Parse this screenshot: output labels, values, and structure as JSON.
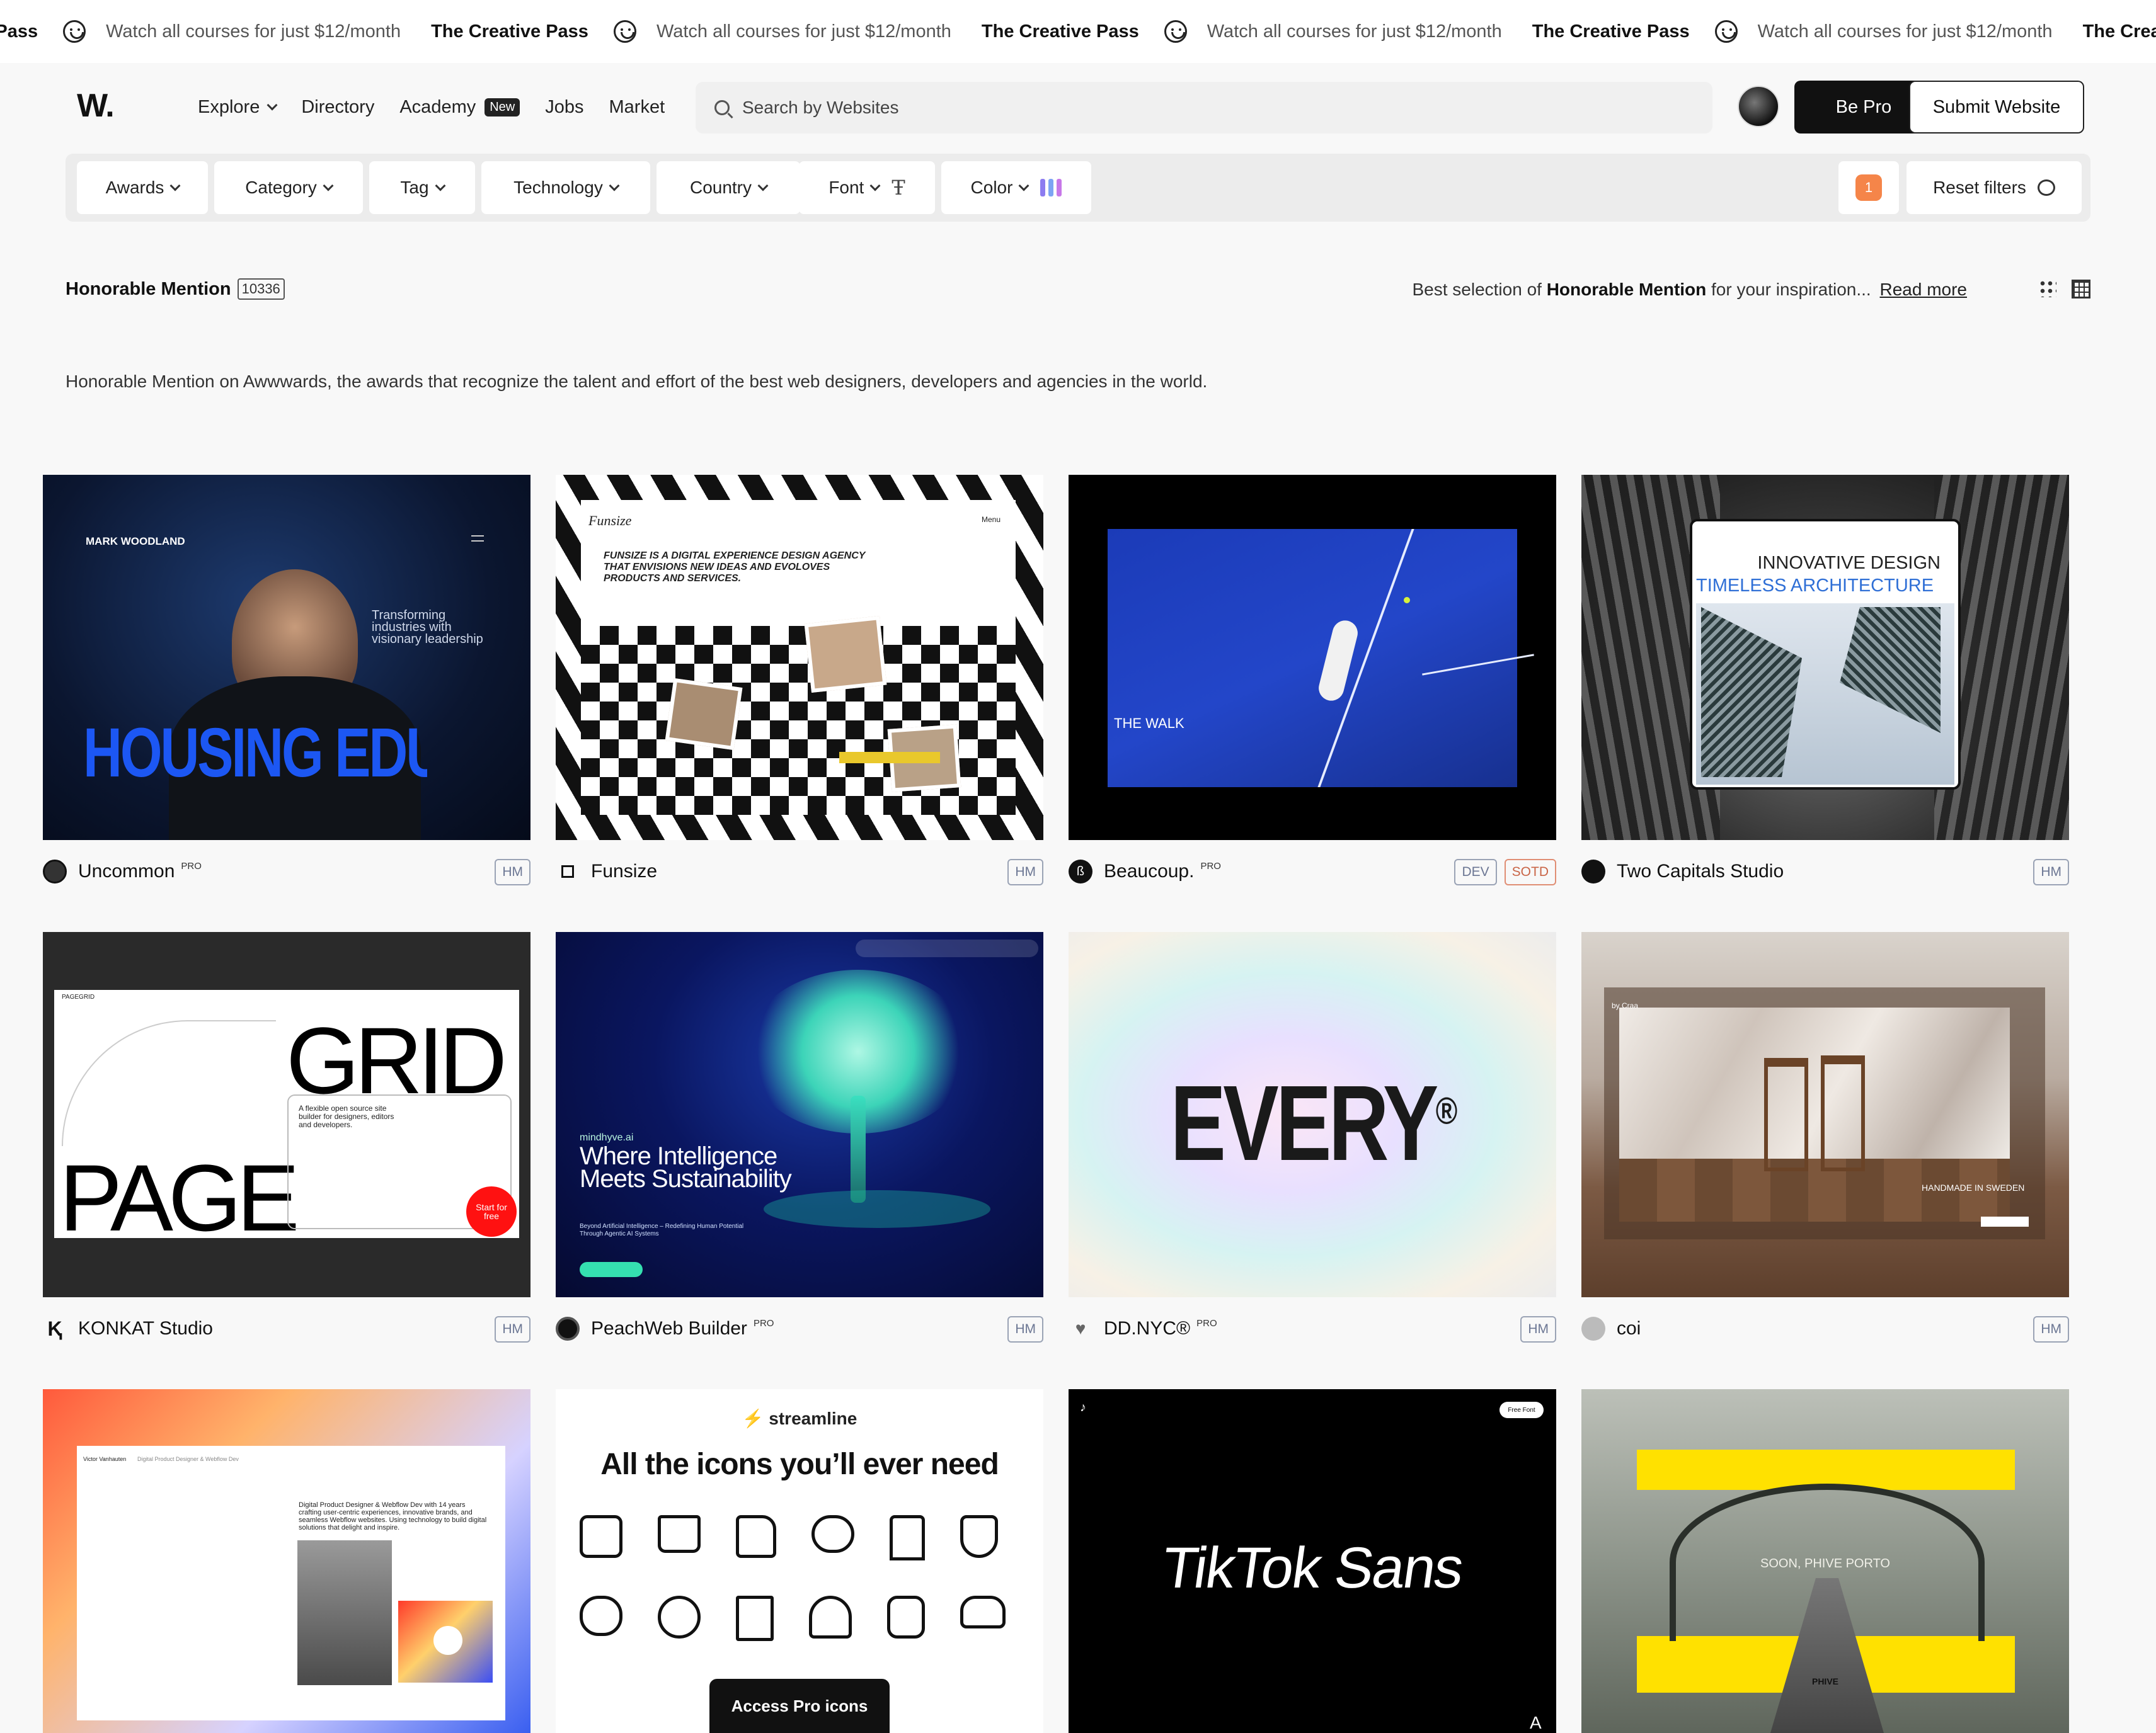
{
  "marquee": {
    "title_partial": "ive Pass",
    "title": "The Creative Pass",
    "text": "Watch all courses for just $12/month"
  },
  "header": {
    "logo": "W.",
    "nav": [
      {
        "label": "Explore"
      },
      {
        "label": "Directory"
      },
      {
        "label": "Academy",
        "badge": "New"
      },
      {
        "label": "Jobs"
      },
      {
        "label": "Market"
      }
    ],
    "search_placeholder": "Search by Websites",
    "be_pro": "Be Pro",
    "submit": "Submit Website"
  },
  "filters": {
    "items": [
      "Awards",
      "Category",
      "Tag",
      "Technology",
      "Country",
      "Font",
      "Color"
    ],
    "color_bars": [
      "#8c7cf0",
      "#7da4f3",
      "#c778e8"
    ],
    "count": "1",
    "reset": "Reset filters",
    "accent": "#f58549"
  },
  "section": {
    "title": "Honorable Mention",
    "count": "10336",
    "best_prefix": "Best selection of",
    "best_bold": "Honorable Mention",
    "best_suffix": "for your inspiration...",
    "read_more": "Read more",
    "description": "Honorable Mention on Awwwards, the awards that recognize the talent and effort of the best web designers, developers and agencies in the world."
  },
  "cards": [
    {
      "name": "Uncommon",
      "pro": "PRO",
      "tags": [
        "HM"
      ],
      "thumb": {
        "brand": "MARK WOODLAND",
        "tagline": "Transforming industries with visionary leadership",
        "hero": "HOUSING EDUCATION"
      }
    },
    {
      "name": "Funsize",
      "pro": "",
      "tags": [
        "HM"
      ],
      "thumb": {
        "brand": "Funsize",
        "menu": "Menu",
        "headline": "FUNSIZE IS A DIGITAL EXPERIENCE DESIGN AGENCY THAT ENVISIONS NEW IDEAS AND EVOLOVES PRODUCTS AND SERVICES."
      }
    },
    {
      "name": "Beaucoup.",
      "pro": "PRO",
      "tags": [
        "DEV",
        "SOTD"
      ],
      "thumb": {
        "label": "THE WALK"
      }
    },
    {
      "name": "Two Capitals Studio",
      "pro": "",
      "tags": [
        "HM"
      ],
      "thumb": {
        "line1": "INNOVATIVE DESIGN",
        "line2": "TIMELESS ARCHITECTURE"
      }
    },
    {
      "name": "KONKAT Studio",
      "pro": "",
      "tags": [
        "HM"
      ],
      "thumb": {
        "brand": "PAGEGRID",
        "big1": "GRID",
        "big2": "PAGE",
        "blurb": "A flexible open source site builder for designers, editors and developers.",
        "cta": "Start for free"
      }
    },
    {
      "name": "PeachWeb Builder",
      "pro": "PRO",
      "tags": [
        "HM"
      ],
      "thumb": {
        "domain": "mindhyve.ai",
        "headline": "Where Intelligence Meets Sustainability",
        "sub": "Beyond Artificial Intelligence – Redefining Human Potential Through Agentic AI Systems"
      }
    },
    {
      "name": "DD.NYC®",
      "pro": "PRO",
      "tags": [
        "HM"
      ],
      "thumb": {
        "word": "EVERY",
        "mark": "®"
      }
    },
    {
      "name": "coi",
      "pro": "",
      "tags": [
        "HM"
      ],
      "thumb": {
        "brand": "by Craa",
        "label": "HANDMADE IN SWEDEN"
      }
    },
    {
      "name": "",
      "pro": "",
      "tags": [],
      "thumb": {
        "name": "Victor Vanhauten",
        "role": "Digital Product Designer & Webflow Dev",
        "bio": "Digital Product Designer & Webflow Dev with 14 years crafting user-centric experiences, innovative brands, and seamless Webflow websites. Using technology to build digital solutions that delight and inspire."
      }
    },
    {
      "name": "",
      "pro": "",
      "tags": [],
      "thumb": {
        "brand": "streamline",
        "headline": "All the icons you’ll ever need",
        "cta": "Access Pro icons"
      }
    },
    {
      "name": "",
      "pro": "",
      "tags": [],
      "thumb": {
        "wordmark": "TikTok Sans",
        "badge": "Free Font",
        "corner": "A"
      }
    },
    {
      "name": "",
      "pro": "",
      "tags": [],
      "thumb": {
        "sign": "SOON, PHIVE PORTO",
        "label": "PHIVE"
      }
    }
  ]
}
